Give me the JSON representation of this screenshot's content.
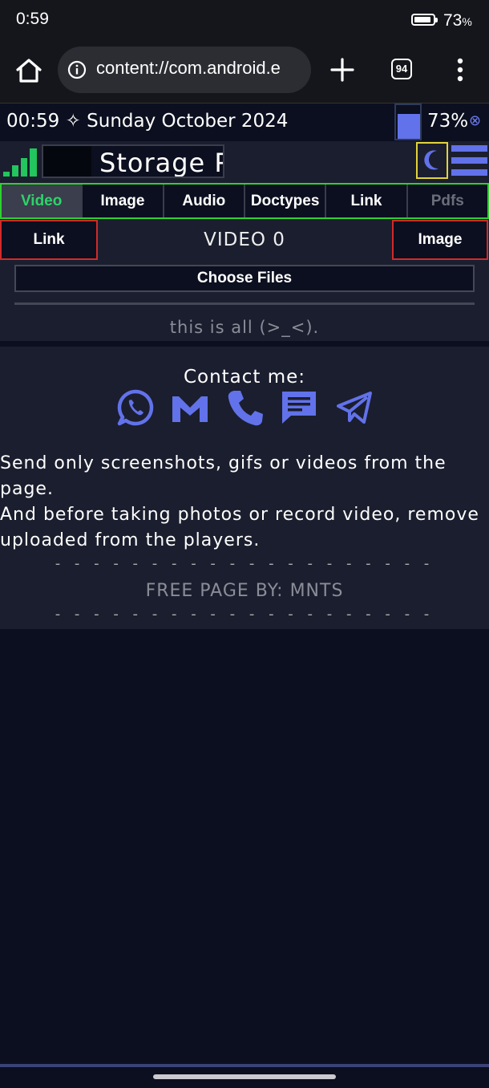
{
  "status_bar": {
    "time": "0:59",
    "battery_value": "73",
    "battery_unit": "%"
  },
  "browser": {
    "url": "content://com.android.e",
    "tab_count": "94"
  },
  "page": {
    "clock": "00:59 ✧ Sunday October 2024",
    "battery": "73%",
    "battery_close": "⊗",
    "battery_level": 0.73,
    "title": "Storage P",
    "tabs": [
      {
        "label": "Video"
      },
      {
        "label": "Image"
      },
      {
        "label": "Audio"
      },
      {
        "label": "Doctypes"
      },
      {
        "label": "Link"
      },
      {
        "label": "Pdfs"
      }
    ],
    "nav": {
      "prev_label": "Link",
      "title": "VIDEO 0",
      "next_label": "Image"
    },
    "choose_files": "Choose Files",
    "end_text": "this is all (>_<).",
    "footer": {
      "contact_title": "Contact me:",
      "contacts": [
        "whatsapp-icon",
        "gmail-icon",
        "phone-icon",
        "sms-icon",
        "telegram-icon"
      ],
      "note_line1": "Send only screenshots, gifs or videos from the page.",
      "note_line2": "And before taking photos or record video, remove uploaded from the players.",
      "dashes": "- - - - - - - - - - - - - - - - - - - -",
      "credit": "FREE PAGE BY: MNTS"
    }
  },
  "colors": {
    "accent": "#6272ea",
    "tab_border": "#2fd02f",
    "active_tab_text": "#2ed36a",
    "nav_border": "#d12a2a",
    "theme_border": "#e2d33a"
  }
}
